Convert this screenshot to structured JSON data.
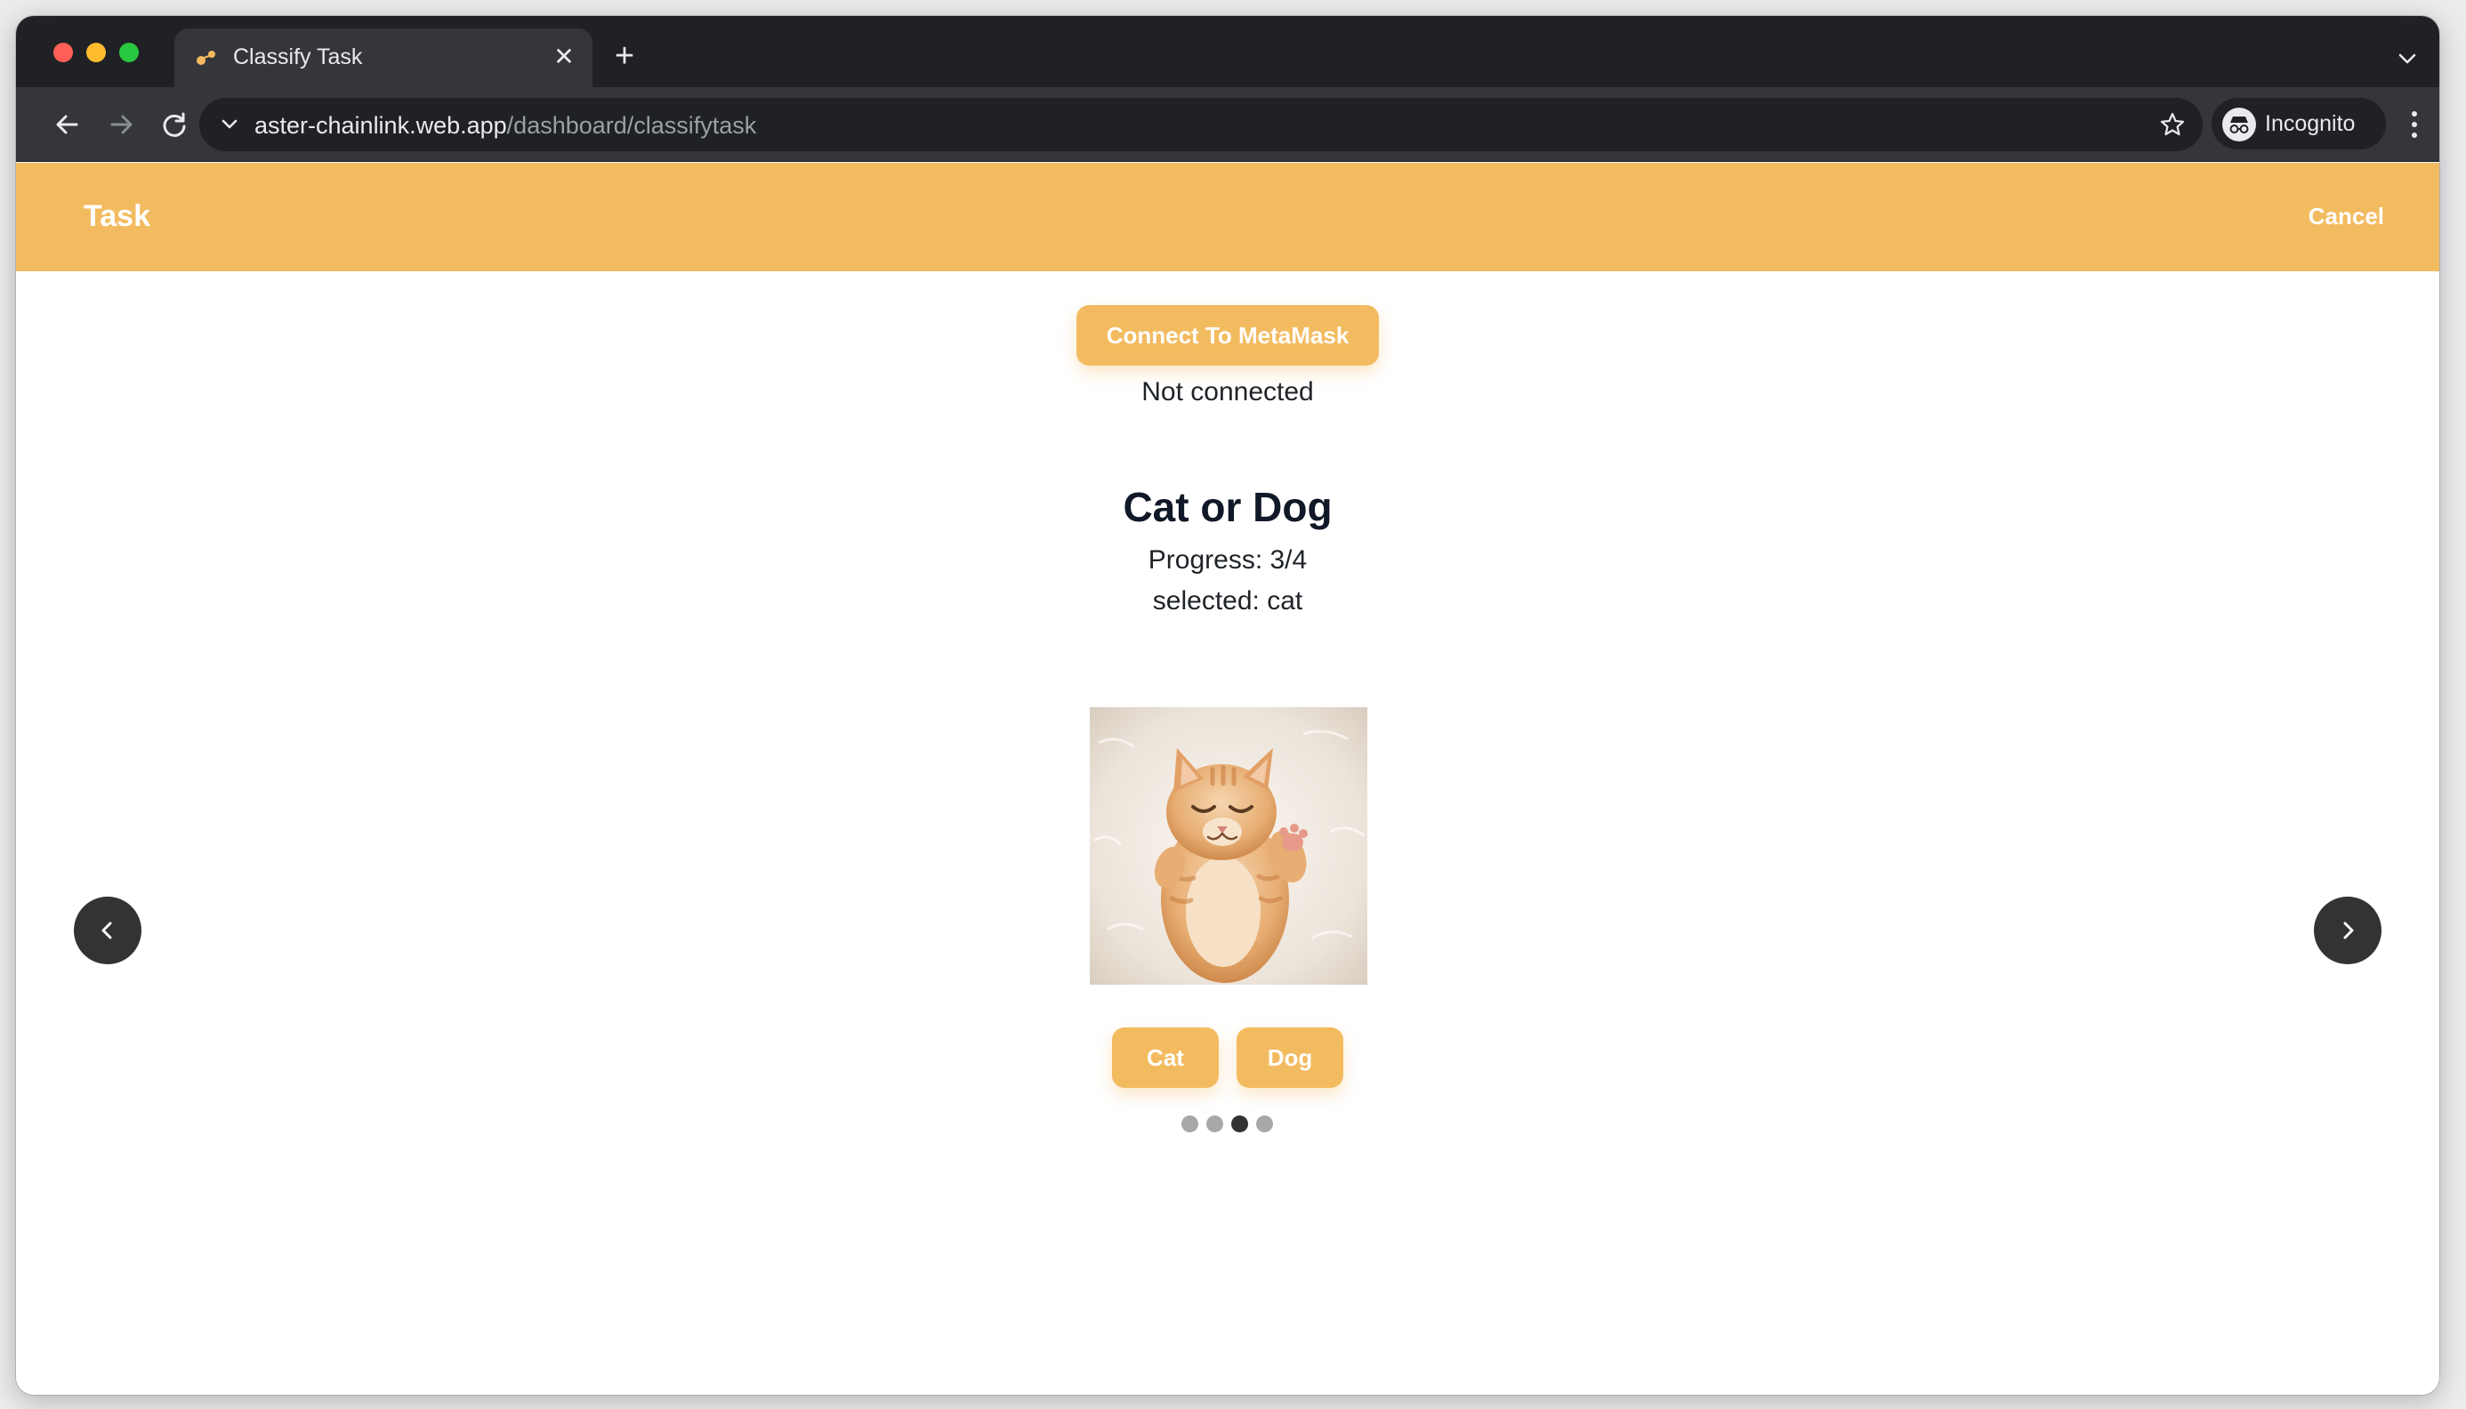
{
  "browser": {
    "tab_title": "Classify Task",
    "tab_close": "✕",
    "new_tab": "+",
    "url_host": "aster-chainlink.web.app",
    "url_path": "/dashboard/classifytask",
    "profile_label": "Incognito"
  },
  "header": {
    "title": "Task",
    "cancel_label": "Cancel"
  },
  "wallet": {
    "connect_label": "Connect To MetaMask",
    "status": "Not connected"
  },
  "task": {
    "title": "Cat or Dog",
    "progress": "Progress: 3/4",
    "selected": "selected: cat"
  },
  "choices": {
    "cat_label": "Cat",
    "dog_label": "Dog"
  },
  "carousel": {
    "total": 4,
    "active_index": 3,
    "image": "ginger-kitten-photo"
  },
  "colors": {
    "accent": "#f3bb60",
    "browser_dark": "#202124",
    "arrow_bg": "#333333"
  },
  "icons": [
    "back-arrow-icon",
    "forward-arrow-icon",
    "reload-icon",
    "chevron-down-icon",
    "star-icon",
    "incognito-icon",
    "more-vert-icon",
    "chevron-left-icon",
    "chevron-right-icon"
  ]
}
